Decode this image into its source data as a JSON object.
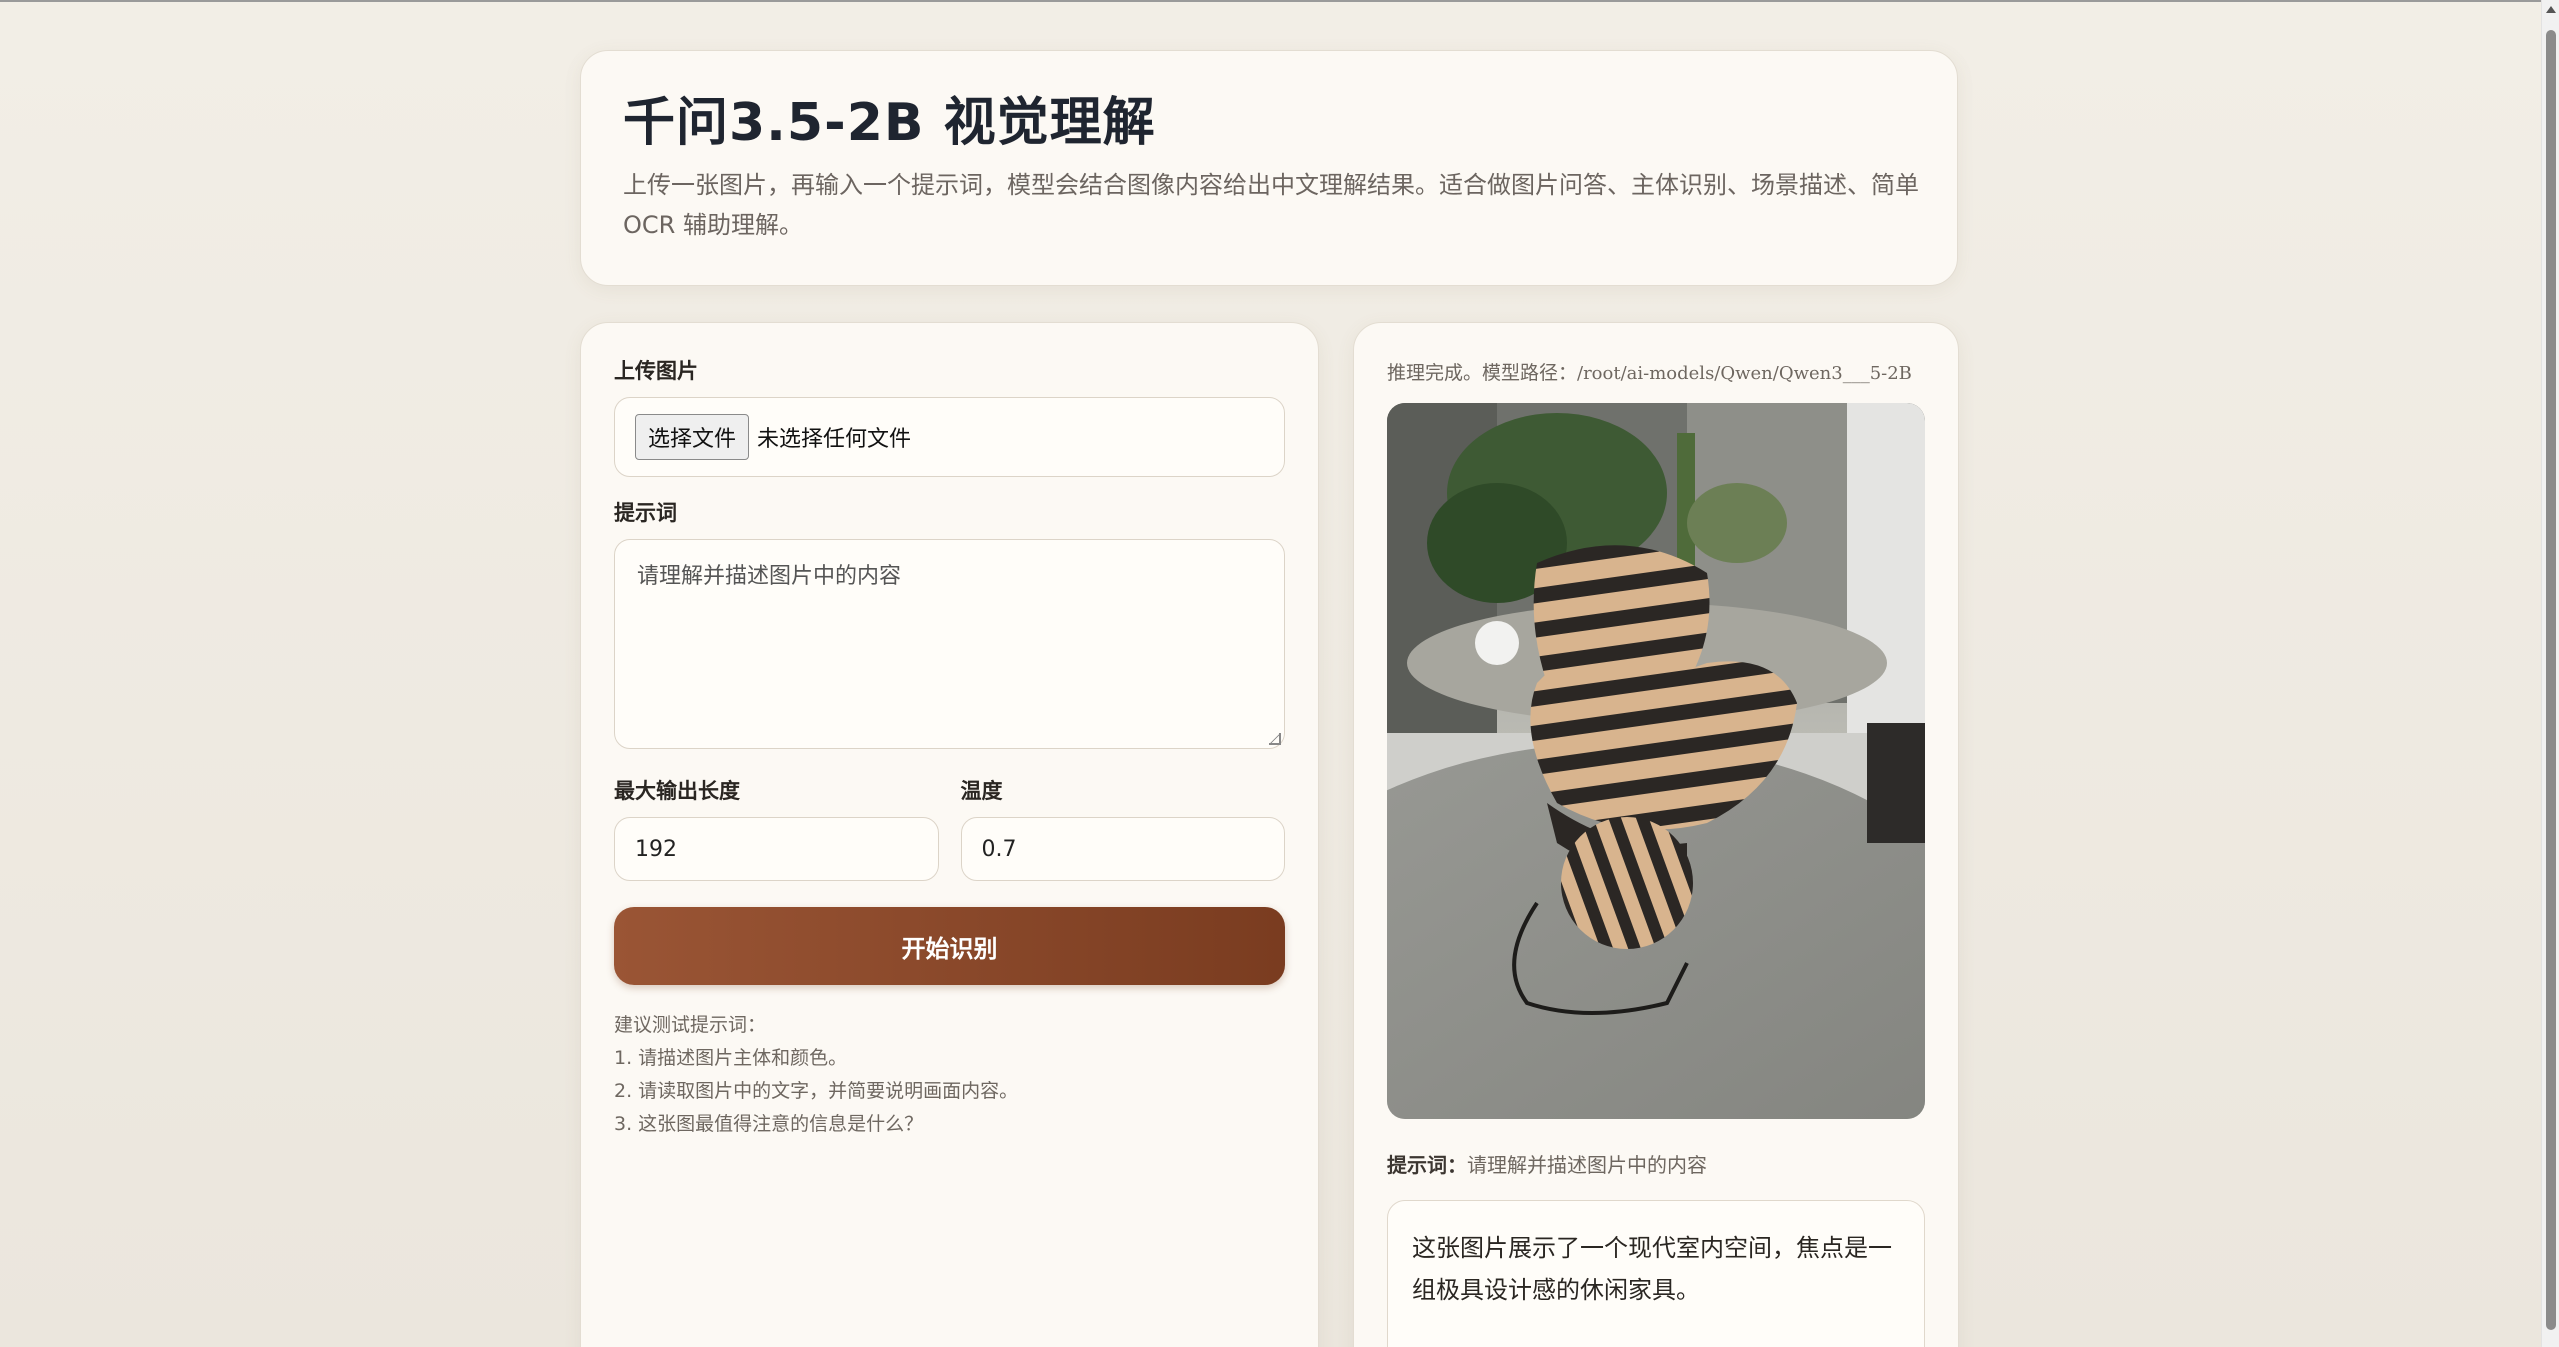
{
  "header": {
    "title": "千问3.5-2B 视觉理解",
    "subtitle": "上传一张图片，再输入一个提示词，模型会结合图像内容给出中文理解结果。适合做图片问答、主体识别、场景描述、简单 OCR 辅助理解。"
  },
  "form": {
    "upload_label": "上传图片",
    "file_button": "选择文件",
    "file_status": "未选择任何文件",
    "prompt_label": "提示词",
    "prompt_value": "请理解并描述图片中的内容",
    "max_len_label": "最大输出长度",
    "max_len_value": "192",
    "temp_label": "温度",
    "temp_value": "0.7",
    "submit_label": "开始识别",
    "tips_title": "建议测试提示词：",
    "tips": [
      "1. 请描述图片主体和颜色。",
      "2. 请读取图片中的文字，并简要说明画面内容。",
      "3. 这张图最值得注意的信息是什么？"
    ]
  },
  "result": {
    "status_text": "推理完成。模型路径：",
    "model_path": "/root/ai-models/Qwen/Qwen3___5-2B",
    "prompt_label": "提示词：",
    "prompt_value": "请理解并描述图片中的内容",
    "answer": "这张图片展示了一个现代室内空间，焦点是一组极具设计感的休闲家具。"
  }
}
